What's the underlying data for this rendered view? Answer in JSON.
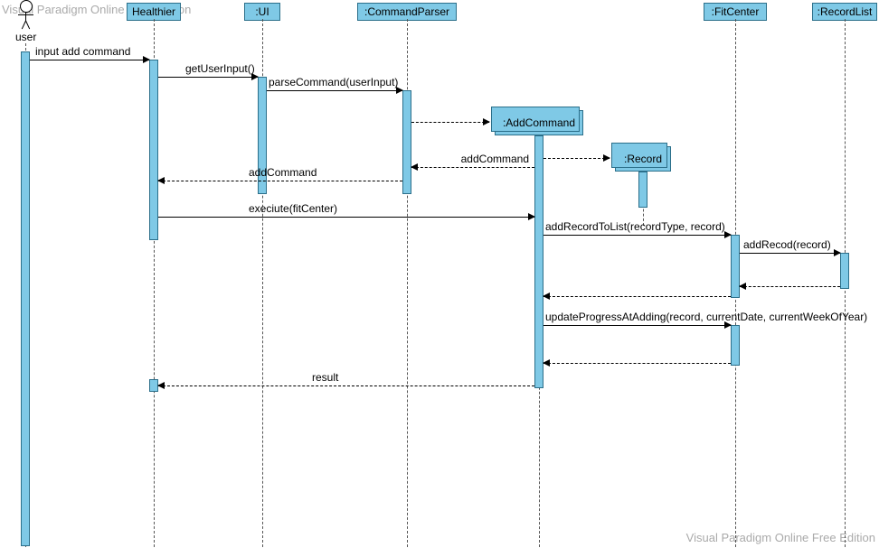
{
  "watermarks": {
    "tl": "Visual Paradigm Online Free Edition",
    "br": "Visual Paradigm Online Free Edition"
  },
  "actor": {
    "label": "user"
  },
  "lifelines": {
    "healthier": "Healthier",
    "ui": ":UI",
    "parser": ":CommandParser",
    "addcmd": ":AddCommand",
    "record": ":Record",
    "fitcenter": ":FitCenter",
    "recordlist": ":RecordList"
  },
  "messages": {
    "m1": "input add command",
    "m2": "getUserInput()",
    "m3": "parseCommand(userInput)",
    "m4": "addCommand",
    "m5": "addCommand",
    "m6": "execiute(fitCenter)",
    "m7": "addRecordToList(recordType, record)",
    "m8": "addRecod(record)",
    "m9": "updateProgressAtAdding(record, currentDate, currentWeekOfYear)",
    "m10": "result"
  },
  "chart_data": {
    "type": "sequence-diagram",
    "participants": [
      {
        "id": "user",
        "label": "user",
        "kind": "actor"
      },
      {
        "id": "healthier",
        "label": "Healthier",
        "kind": "object"
      },
      {
        "id": "ui",
        "label": ":UI",
        "kind": "object"
      },
      {
        "id": "parser",
        "label": ":CommandParser",
        "kind": "object"
      },
      {
        "id": "addcmd",
        "label": ":AddCommand",
        "kind": "object",
        "created_by": "parser"
      },
      {
        "id": "record",
        "label": ":Record",
        "kind": "object",
        "created_by": "addcmd"
      },
      {
        "id": "fitcenter",
        "label": ":FitCenter",
        "kind": "object"
      },
      {
        "id": "recordlist",
        "label": ":RecordList",
        "kind": "object"
      }
    ],
    "messages": [
      {
        "from": "user",
        "to": "healthier",
        "label": "input add command",
        "type": "sync"
      },
      {
        "from": "healthier",
        "to": "ui",
        "label": "getUserInput()",
        "type": "sync"
      },
      {
        "from": "ui",
        "to": "parser",
        "label": "parseCommand(userInput)",
        "type": "sync"
      },
      {
        "from": "parser",
        "to": "addcmd",
        "label": "",
        "type": "create"
      },
      {
        "from": "addcmd",
        "to": "record",
        "label": "",
        "type": "create"
      },
      {
        "from": "addcmd",
        "to": "parser",
        "label": "addCommand",
        "type": "return"
      },
      {
        "from": "parser",
        "to": "healthier",
        "label": "addCommand",
        "type": "return"
      },
      {
        "from": "healthier",
        "to": "addcmd",
        "label": "execiute(fitCenter)",
        "type": "sync"
      },
      {
        "from": "addcmd",
        "to": "fitcenter",
        "label": "addRecordToList(recordType, record)",
        "type": "sync"
      },
      {
        "from": "fitcenter",
        "to": "recordlist",
        "label": "addRecod(record)",
        "type": "sync"
      },
      {
        "from": "recordlist",
        "to": "fitcenter",
        "label": "",
        "type": "return"
      },
      {
        "from": "fitcenter",
        "to": "addcmd",
        "label": "",
        "type": "return"
      },
      {
        "from": "addcmd",
        "to": "fitcenter",
        "label": "updateProgressAtAdding(record, currentDate, currentWeekOfYear)",
        "type": "sync"
      },
      {
        "from": "fitcenter",
        "to": "addcmd",
        "label": "",
        "type": "return"
      },
      {
        "from": "addcmd",
        "to": "healthier",
        "label": "result",
        "type": "return"
      }
    ]
  }
}
